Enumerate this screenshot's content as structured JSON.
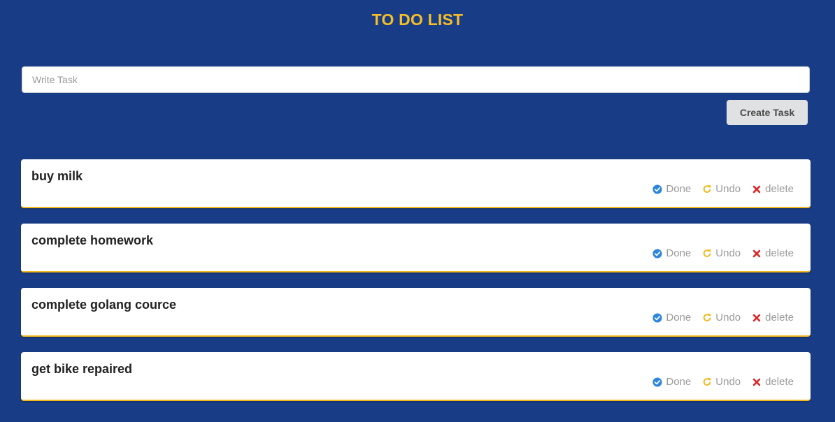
{
  "header": {
    "title": "TO DO LIST"
  },
  "form": {
    "placeholder": "Write Task",
    "value": "",
    "create_label": "Create Task"
  },
  "actions": {
    "done_label": "Done",
    "undo_label": "Undo",
    "delete_label": "delete"
  },
  "colors": {
    "background": "#183d86",
    "title": "#f6be27",
    "done_icon": "#2e86de",
    "undo_icon": "#f2b81e",
    "delete_icon": "#db2828",
    "card_accent": "#f2b81e"
  },
  "icons": {
    "done": "check-circle-icon",
    "undo": "redo-arrow-icon",
    "delete": "close-x-icon"
  },
  "tasks": [
    {
      "name": "buy milk"
    },
    {
      "name": "complete homework"
    },
    {
      "name": "complete golang cource"
    },
    {
      "name": "get bike repaired"
    }
  ]
}
